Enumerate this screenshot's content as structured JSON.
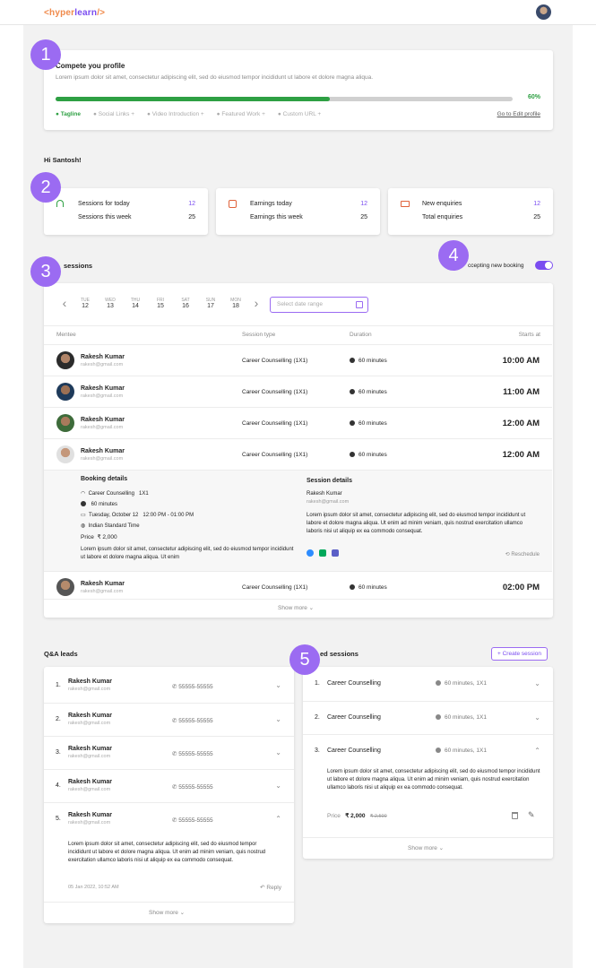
{
  "header": {
    "logo_open": "<",
    "logo_a": "hyper",
    "logo_b": "learn",
    "logo_close": "/>"
  },
  "profile": {
    "title": "Compete you profile",
    "desc": "Lorem ipsum dolor sit amet, consectetur adipiscing elit, sed do eiusmod tempor incididunt ut labore et dolore magna aliqua.",
    "percent": "60%",
    "progress_fraction": 0.6,
    "steps": [
      "Tagline",
      "Social Links",
      "Video Introduction",
      "Featured Work",
      "Custom URL"
    ],
    "edit_link": "Go to Edit profile"
  },
  "greeting": "Hi Santosh!",
  "stats": [
    {
      "l1": "Sessions for today",
      "v1": "12",
      "l2": "Sessions this week",
      "v2": "25"
    },
    {
      "l1": "Earnings today",
      "v1": "12",
      "l2": "Earnings this week",
      "v2": "25"
    },
    {
      "l1": "New enquiries",
      "v1": "12",
      "l2": "Total enquiries",
      "v2": "25"
    }
  ],
  "sessions": {
    "title": "sessions",
    "accepting_label": "ccepting new booking",
    "dates": [
      {
        "d": "TUE",
        "n": "12"
      },
      {
        "d": "WED",
        "n": "13"
      },
      {
        "d": "THU",
        "n": "14"
      },
      {
        "d": "FRI",
        "n": "15"
      },
      {
        "d": "SAT",
        "n": "16"
      },
      {
        "d": "SUN",
        "n": "17"
      },
      {
        "d": "MON",
        "n": "18"
      }
    ],
    "date_placeholder": "Select date range",
    "headers": {
      "mentee": "Mentee",
      "type": "Session type",
      "duration": "Duration",
      "starts": "Starts at"
    },
    "rows": [
      {
        "name": "Rakesh Kumar",
        "email": "rakesh@gmail.com",
        "type": "Career Counselling (1X1)",
        "duration": "60 minutes",
        "time": "10:00 AM"
      },
      {
        "name": "Rakesh Kumar",
        "email": "rakesh@gmail.com",
        "type": "Career Counselling (1X1)",
        "duration": "60 minutes",
        "time": "11:00 AM"
      },
      {
        "name": "Rakesh Kumar",
        "email": "rakesh@gmail.com",
        "type": "Career Counselling (1X1)",
        "duration": "60 minutes",
        "time": "12:00 AM"
      },
      {
        "name": "Rakesh Kumar",
        "email": "rakesh@gmail.com",
        "type": "Career Counselling (1X1)",
        "duration": "60 minutes",
        "time": "12:00 AM"
      }
    ],
    "detail": {
      "booking_title": "Booking details",
      "session_type": "Career Counselling",
      "session_kind": "1X1",
      "duration": "60 minutes",
      "date": "Tuesday, October 12",
      "time_range": "12:00 PM - 01:00 PM",
      "timezone": "Indian Standard Time",
      "price_label": "Price",
      "price": "₹ 2,000",
      "note": "Lorem ipsum dolor sit amet, consectetur adipiscing elit, sed do eiusmod tempor incididunt ut labore et dolore magna aliqua. Ut enim",
      "session_title": "Session details",
      "mentee_name": "Rakesh Kumar",
      "mentee_email": "rakesh@gmail.com",
      "session_desc": "Lorem ipsum dolor sit amet, consectetur adipiscing elit, sed do eiusmod tempor incididunt ut labore et dolore magna aliqua. Ut enim ad minim veniam, quis nostrud exercitation ullamco laboris nisi ut aliquip ex ea commodo consequat.",
      "reschedule": "Reschedule"
    },
    "last_row": {
      "name": "Rakesh Kumar",
      "email": "rakesh@gmail.com",
      "type": "Career Counselling (1X1)",
      "duration": "60 minutes",
      "time": "02:00 PM"
    },
    "show_more": "Show more"
  },
  "qa": {
    "title": "Q&A leads",
    "rows": [
      {
        "num": "1.",
        "name": "Rakesh Kumar",
        "email": "rakesh@gmail.com",
        "phone": "55555-55555"
      },
      {
        "num": "2.",
        "name": "Rakesh Kumar",
        "email": "rakesh@gmail.com",
        "phone": "55555-55555"
      },
      {
        "num": "3.",
        "name": "Rakesh Kumar",
        "email": "rakesh@gmail.com",
        "phone": "55555-55555"
      },
      {
        "num": "4.",
        "name": "Rakesh Kumar",
        "email": "rakesh@gmail.com",
        "phone": "55555-55555"
      },
      {
        "num": "5.",
        "name": "Rakesh Kumar",
        "email": "rakesh@gmail.com",
        "phone": "55555-55555"
      }
    ],
    "expanded_text": "Lorem ipsum dolor sit amet, consectetur adipiscing elit, sed do eiusmod tempor incididunt ut labore et dolore magna aliqua. Ut enim ad minim veniam, quis nostrud exercitation ullamco laboris nisi ut aliquip ex ea commodo consequat.",
    "expanded_date": "05 Jan 2022, 10:52 AM",
    "reply": "Reply",
    "show_more": "Show more"
  },
  "featured": {
    "title": "ed sessions",
    "create_btn": "+ Create session",
    "rows": [
      {
        "num": "1.",
        "name": "Career Counselling",
        "duration": "60 minutes, 1X1"
      },
      {
        "num": "2.",
        "name": "Career Counselling",
        "duration": "60 minutes, 1X1"
      },
      {
        "num": "3.",
        "name": "Career Counselling",
        "duration": "60 minutes, 1X1"
      }
    ],
    "expanded_text": "Lorem ipsum dolor sit amet, consectetur adipiscing elit, sed do eiusmod tempor incididunt ut labore et dolore magna aliqua. Ut enim ad minim veniam, quis nostrud exercitation ullamco laboris nisi ut aliquip ex ea commodo consequat.",
    "price_label": "Price",
    "price": "₹ 2,000",
    "old_price": "₹ 2,500",
    "show_more": "Show more"
  },
  "badges": [
    "1",
    "2",
    "3",
    "4",
    "5"
  ],
  "colors": {
    "accent": "#7a4cf0",
    "badge": "#9b6bf2",
    "success": "#2ea043",
    "logo_orange": "#f08a4b"
  }
}
